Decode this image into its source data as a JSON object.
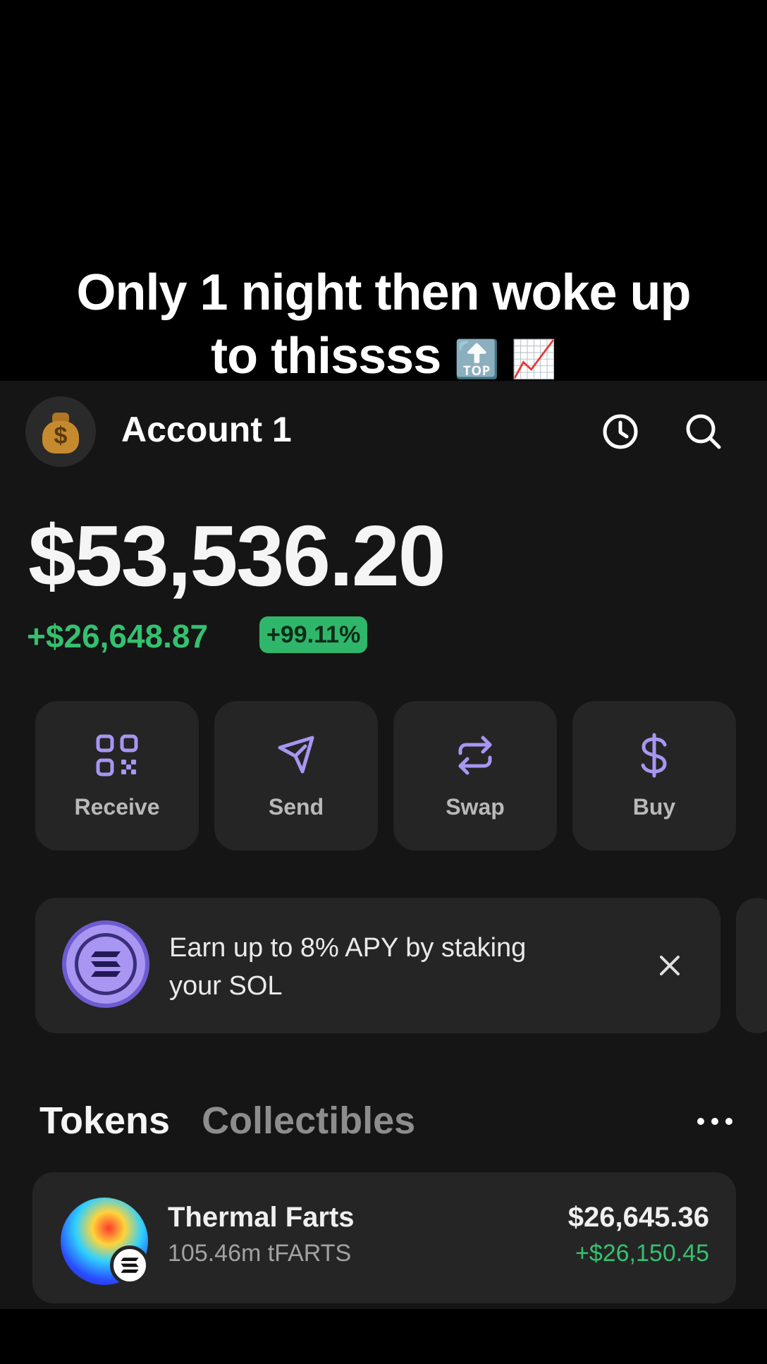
{
  "caption": {
    "line1": "Only 1 night then woke up",
    "line2": "to thissss",
    "emoji": "🔝 📈"
  },
  "header": {
    "account_name": "Account 1",
    "avatar_icon": "money-bag-icon",
    "avatar_symbol": "$",
    "history_icon": "clock-icon",
    "search_icon": "search-icon"
  },
  "balance": {
    "total": "$53,536.20",
    "change": "+$26,648.87",
    "change_pct": "+99.11%"
  },
  "actions": [
    {
      "label": "Receive",
      "icon": "qr-code-icon"
    },
    {
      "label": "Send",
      "icon": "paper-plane-icon"
    },
    {
      "label": "Swap",
      "icon": "swap-arrows-icon"
    },
    {
      "label": "Buy",
      "icon": "dollar-icon"
    }
  ],
  "banner": {
    "text": "Earn up to 8% APY by staking your SOL",
    "icon": "solana-icon",
    "close_icon": "close-icon"
  },
  "tabs": {
    "tokens": "Tokens",
    "collectibles": "Collectibles",
    "more_icon": "more-icon"
  },
  "tokens": [
    {
      "name": "Thermal Farts",
      "amount": "105.46m tFARTS",
      "value": "$26,645.36",
      "change": "+$26,150.45"
    }
  ],
  "colors": {
    "accent_purple": "#a896f2",
    "positive_green": "#34c16f",
    "card_bg": "#252525",
    "app_bg": "#151515"
  }
}
